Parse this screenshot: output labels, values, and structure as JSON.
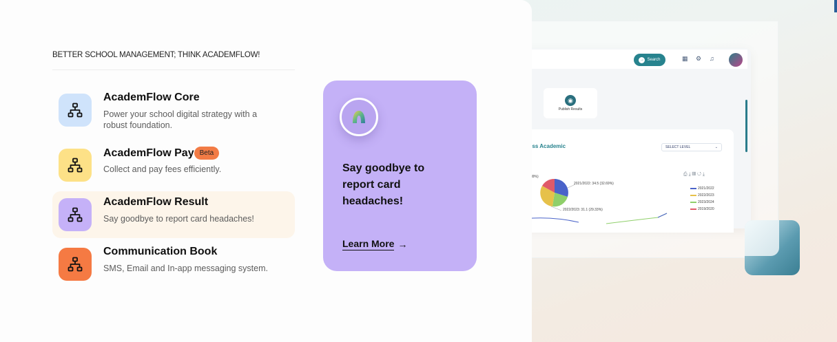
{
  "tagline": "BETTER SCHOOL MANAGEMENT; THINK ACADEMFLOW!",
  "menu": {
    "items": [
      {
        "title": "AcademFlow Core",
        "desc": "Power your school digital strategy with a robust foundation.",
        "icon": "sitemap-icon",
        "color": "#cfe3fb"
      },
      {
        "title": "AcademFlow Pay",
        "badge": "Beta",
        "desc": "Collect and pay fees efficiently.",
        "icon": "sitemap-icon",
        "color": "#fde187"
      },
      {
        "title": "AcademFlow Result",
        "desc": "Say goodbye to report card headaches!",
        "icon": "sitemap-icon",
        "color": "#c5b1f8",
        "active": true
      },
      {
        "title": "Communication Book",
        "desc": "SMS, Email and In-app messaging system.",
        "icon": "sitemap-icon",
        "color": "#f57a43"
      }
    ]
  },
  "promo": {
    "text": "Say goodbye to report card headaches!",
    "link": "Learn More",
    "color": "#c4b1f7"
  },
  "dashboard": {
    "search_label": "Search",
    "publish_label": "Publish Results",
    "panel_title": "ess Academic",
    "select_level": "SELECT LEVEL",
    "pie_labels": [
      "2021/2022: 34.5 (32.69%)",
      "2022/2023: 31.1 (29.33%)",
      "39%)"
    ],
    "legend": [
      {
        "label": "2021/2022",
        "color": "#4a63c9"
      },
      {
        "label": "2022/2023",
        "color": "#e6c14a"
      },
      {
        "label": "2023/2024",
        "color": "#8fcf6a"
      },
      {
        "label": "2019/2020",
        "color": "#e05a6a"
      }
    ],
    "brand_color": "#27838e"
  }
}
